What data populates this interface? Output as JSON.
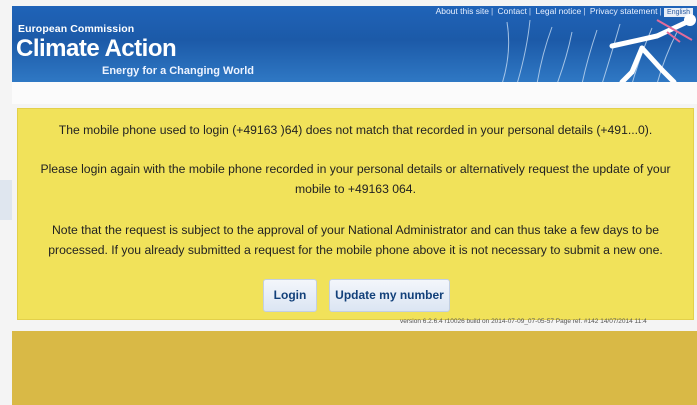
{
  "header": {
    "links": [
      "About this site",
      "Contact",
      "Legal notice",
      "Privacy statement"
    ],
    "language": "English",
    "org": "European Commission",
    "title": "Climate Action",
    "tagline": "Energy for a Changing World"
  },
  "notice": {
    "line1": "The mobile phone used to login (+49163        )64) does not match that recorded in your personal details (+491...0).",
    "line2a": "Please login again with the mobile phone recorded in your personal details or alternatively request the update of your",
    "line2b": "mobile to +49163        064.",
    "line3a": "Note that the request is subject to the approval of your National Administrator and can thus take a few days to be",
    "line3b": "processed. If you already submitted a request for the mobile phone above it is not necessary to submit a new one."
  },
  "buttons": {
    "login": "Login",
    "update": "Update my number"
  },
  "version": "version 6.2.6.4 r10026 build on 2014-07-09_07-05-57   Page ref. #142 14/07/2014 11:4"
}
